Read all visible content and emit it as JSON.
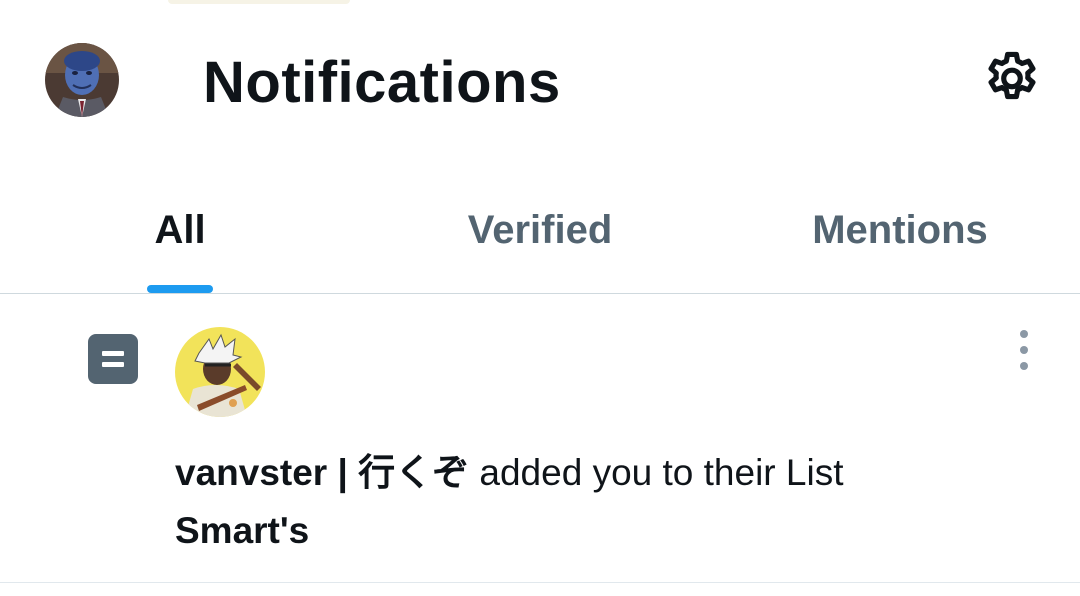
{
  "header": {
    "title": "Notifications",
    "avatar_icon": "user-avatar-blue-character",
    "settings_icon": "gear-icon"
  },
  "tabs": [
    {
      "label": "All",
      "active": true
    },
    {
      "label": "Verified",
      "active": false
    },
    {
      "label": "Mentions",
      "active": false
    }
  ],
  "notification": {
    "type_icon": "list-icon",
    "actor_avatar_icon": "user-avatar-white-hair-character",
    "actor_name": "vanvster | 行くぞ",
    "action_text": "added you to their List",
    "list_name": "Smart's",
    "more_icon": "more-vertical-icon"
  },
  "colors": {
    "accent": "#1d9bf0",
    "text_primary": "#0f1419",
    "text_secondary": "#536471",
    "divider": "#cfd9de"
  }
}
